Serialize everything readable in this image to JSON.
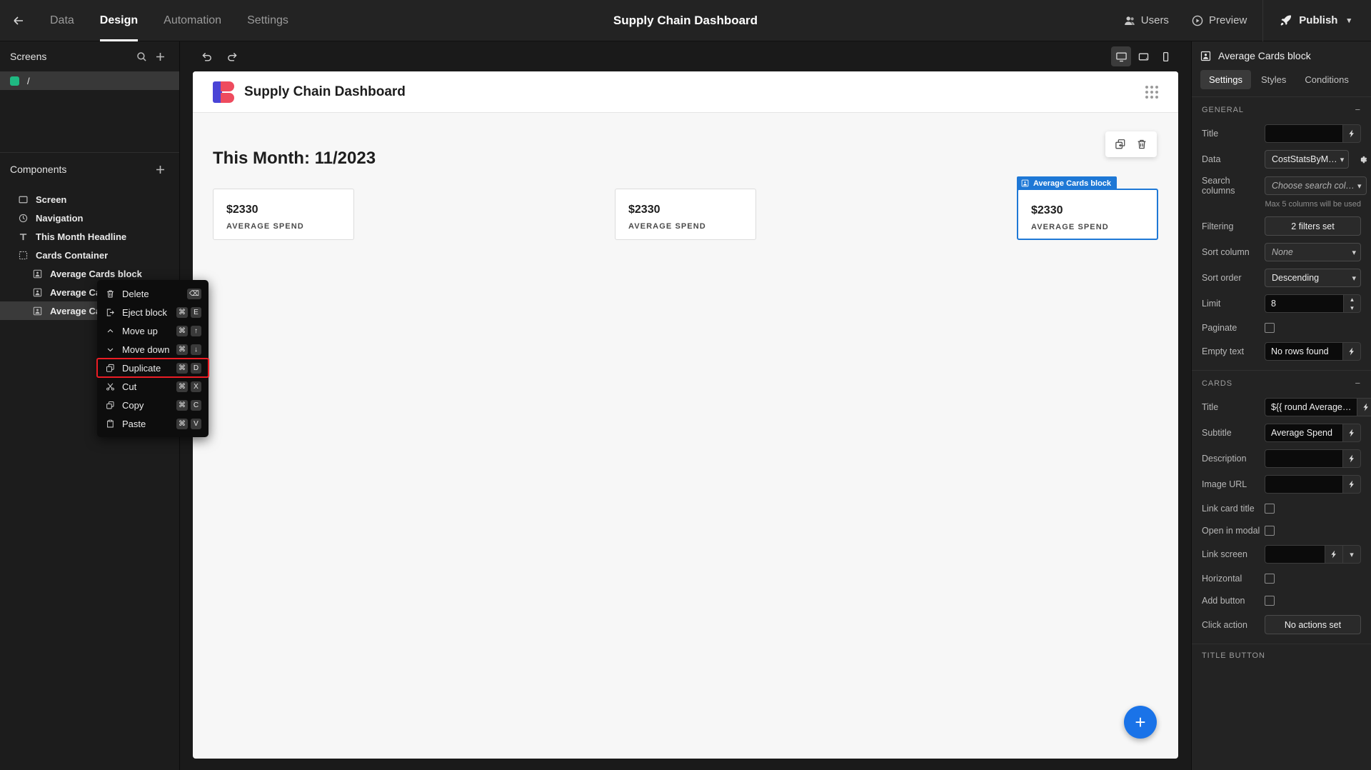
{
  "topbar": {
    "back_icon": "arrow-left-icon",
    "tabs": [
      {
        "label": "Data",
        "active": false
      },
      {
        "label": "Design",
        "active": true
      },
      {
        "label": "Automation",
        "active": false
      },
      {
        "label": "Settings",
        "active": false
      }
    ],
    "title": "Supply Chain Dashboard",
    "users_label": "Users",
    "preview_label": "Preview",
    "publish_label": "Publish"
  },
  "left_panel": {
    "screens_title": "Screens",
    "screens": [
      {
        "label": "/",
        "color": "#1fb982",
        "selected": true
      }
    ],
    "components_title": "Components",
    "components": [
      {
        "label": "Screen",
        "icon": "screen-icon",
        "indent": 0,
        "selected": false
      },
      {
        "label": "Navigation",
        "icon": "navigation-icon",
        "indent": 0,
        "selected": false
      },
      {
        "label": "This Month Headline",
        "icon": "text-icon",
        "indent": 0,
        "selected": false
      },
      {
        "label": "Cards Container",
        "icon": "container-icon",
        "indent": 0,
        "selected": false
      },
      {
        "label": "Average Cards block",
        "icon": "card-block-icon",
        "indent": 1,
        "selected": false
      },
      {
        "label": "Average Cards block",
        "icon": "card-block-icon",
        "indent": 1,
        "selected": false
      },
      {
        "label": "Average Cards block",
        "icon": "card-block-icon",
        "indent": 1,
        "selected": true
      }
    ]
  },
  "context_menu": {
    "items": [
      {
        "label": "Delete",
        "icon": "trash-icon",
        "keys": [
          "⌫"
        ],
        "highlight": false
      },
      {
        "label": "Eject block",
        "icon": "eject-icon",
        "keys": [
          "⌘",
          "E"
        ],
        "highlight": false
      },
      {
        "label": "Move up",
        "icon": "chevron-up-icon",
        "keys": [
          "⌘",
          "↑"
        ],
        "highlight": false
      },
      {
        "label": "Move down",
        "icon": "chevron-down-icon",
        "keys": [
          "⌘",
          "↓"
        ],
        "highlight": false
      },
      {
        "label": "Duplicate",
        "icon": "duplicate-icon",
        "keys": [
          "⌘",
          "D"
        ],
        "highlight": true
      },
      {
        "label": "Cut",
        "icon": "scissors-icon",
        "keys": [
          "⌘",
          "X"
        ],
        "highlight": false
      },
      {
        "label": "Copy",
        "icon": "copy-icon",
        "keys": [
          "⌘",
          "C"
        ],
        "highlight": false
      },
      {
        "label": "Paste",
        "icon": "paste-icon",
        "keys": [
          "⌘",
          "V"
        ],
        "highlight": false
      }
    ]
  },
  "center": {
    "undo_icon": "undo-icon",
    "redo_icon": "redo-icon",
    "devices": [
      {
        "name": "desktop-icon",
        "active": true
      },
      {
        "name": "tablet-icon",
        "active": false
      },
      {
        "name": "mobile-icon",
        "active": false
      }
    ]
  },
  "preview": {
    "nav_title": "Supply Chain Dashboard",
    "headline": "This Month: 11/2023",
    "cards": [
      {
        "amount": "$2330",
        "subtitle": "AVERAGE SPEND",
        "selected": false
      },
      {
        "amount": "$2330",
        "subtitle": "AVERAGE SPEND",
        "selected": false
      },
      {
        "amount": "$2330",
        "subtitle": "AVERAGE SPEND",
        "selected": true
      }
    ],
    "selected_tag": "Average Cards block",
    "fab_label": "+",
    "tools": [
      "duplicate-icon",
      "trash-icon"
    ]
  },
  "right_panel": {
    "block_title": "Average Cards block",
    "tabs": [
      {
        "label": "Settings",
        "active": true
      },
      {
        "label": "Styles",
        "active": false
      },
      {
        "label": "Conditions",
        "active": false
      }
    ],
    "general": {
      "section_label": "GENERAL",
      "title_label": "Title",
      "title_value": "",
      "data_label": "Data",
      "data_value": "CostStatsByM…",
      "search_columns_label": "Search columns",
      "search_columns_value": "Choose search col…",
      "search_hint": "Max 5 columns will be used",
      "filtering_label": "Filtering",
      "filtering_value": "2 filters set",
      "sort_column_label": "Sort column",
      "sort_column_value": "None",
      "sort_order_label": "Sort order",
      "sort_order_value": "Descending",
      "limit_label": "Limit",
      "limit_value": "8",
      "paginate_label": "Paginate",
      "paginate_checked": false,
      "empty_text_label": "Empty text",
      "empty_text_value": "No rows found"
    },
    "cards": {
      "section_label": "CARDS",
      "title_label": "Title",
      "title_value": "${{ round Average…",
      "subtitle_label": "Subtitle",
      "subtitle_value": "Average Spend",
      "description_label": "Description",
      "description_value": "",
      "image_url_label": "Image URL",
      "image_url_value": "",
      "link_card_title_label": "Link card title",
      "link_card_title_checked": false,
      "open_in_modal_label": "Open in modal",
      "open_in_modal_checked": false,
      "link_screen_label": "Link screen",
      "link_screen_value": "",
      "horizontal_label": "Horizontal",
      "horizontal_checked": false,
      "add_button_label": "Add button",
      "add_button_checked": false,
      "click_action_label": "Click action",
      "click_action_value": "No actions set"
    },
    "title_button": {
      "section_label": "TITLE BUTTON"
    }
  }
}
